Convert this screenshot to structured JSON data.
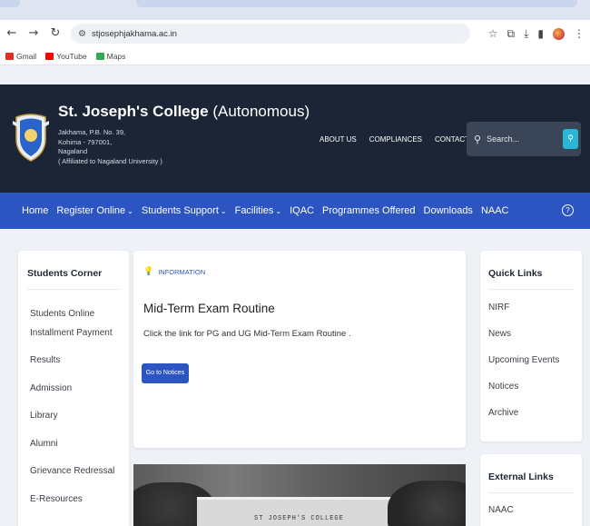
{
  "browser": {
    "url": "stjosephjakhama.ac.in",
    "bookmarks": [
      {
        "label": "Gmail",
        "color": "#d93025"
      },
      {
        "label": "YouTube",
        "color": "#ff0000"
      },
      {
        "label": "Maps",
        "color": "#34a853"
      }
    ]
  },
  "site": {
    "name_bold": "St. Joseph's College",
    "name_light": "(Autonomous)",
    "address": [
      "Jakhama, P.B. No. 39,",
      "Kohima - 797001,",
      "Nagaland",
      "( Affiliated to Nagaland University )"
    ],
    "header_links": [
      "ABOUT US",
      "COMPLIANCES",
      "CONTACT US"
    ],
    "search_placeholder": "Search..."
  },
  "nav": [
    {
      "label": "Home",
      "dropdown": false
    },
    {
      "label": "Register Online",
      "dropdown": true
    },
    {
      "label": "Students Support",
      "dropdown": true
    },
    {
      "label": "Facilities",
      "dropdown": true
    },
    {
      "label": "IQAC",
      "dropdown": false
    },
    {
      "label": "Programmes Offered",
      "dropdown": false
    },
    {
      "label": "Downloads",
      "dropdown": false
    },
    {
      "label": "NAAC",
      "dropdown": false
    }
  ],
  "students_corner": {
    "title": "Students Corner",
    "items": [
      "Students Online Installment Payment",
      "Results",
      "Admission",
      "Library",
      "Alumni",
      "Grievance Redressal",
      "E-Resources"
    ]
  },
  "information": {
    "tag": "INFORMATION",
    "title": "Mid-Term Exam Routine",
    "description": "Click the link for PG and UG Mid-Term Exam Routine .",
    "button": "Go to Notices"
  },
  "photo_caption": "ST JOSEPH'S COLLEGE",
  "quick_links": {
    "title": "Quick Links",
    "items": [
      "NIRF",
      "News",
      "Upcoming Events",
      "Notices",
      "Archive"
    ]
  },
  "external_links": {
    "title": "External Links",
    "items": [
      "NAAC"
    ]
  },
  "colors": {
    "header_bg": "#1b2536",
    "nav_bg": "#2d55c2",
    "search_button": "#28b7d6"
  }
}
